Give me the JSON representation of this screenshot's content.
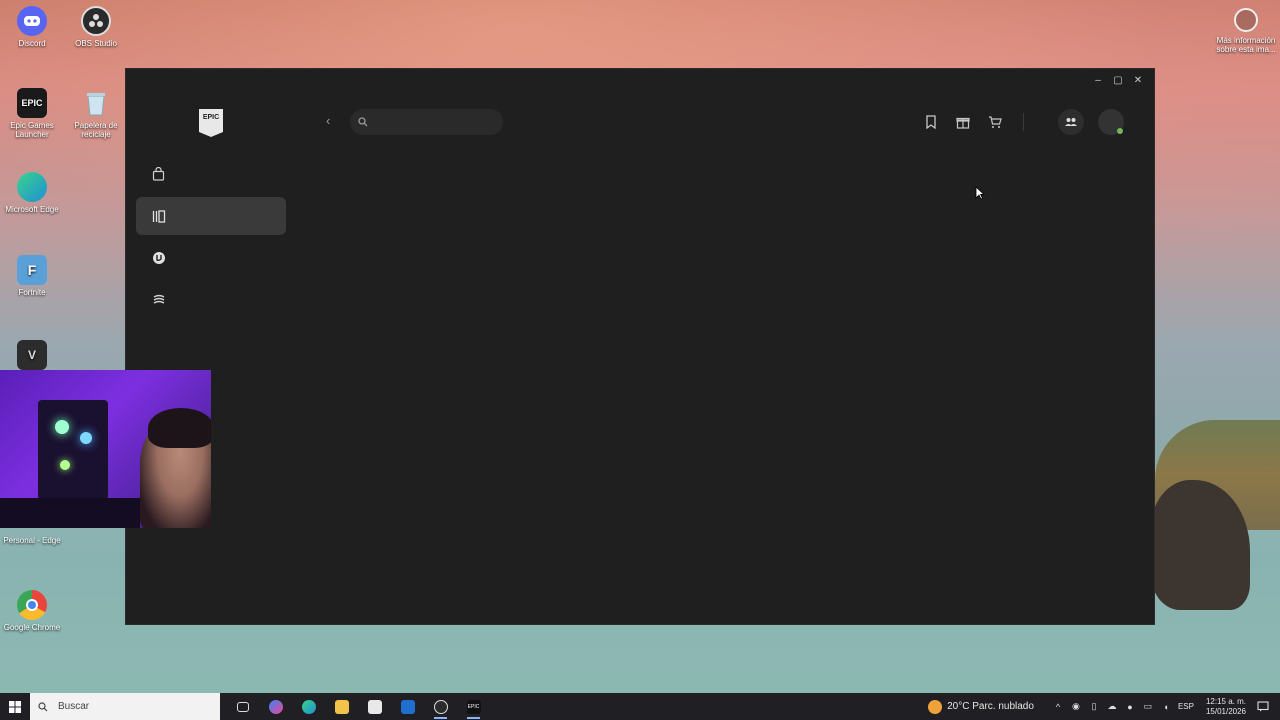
{
  "desktop": {
    "icons": [
      {
        "label": "Discord",
        "icon": "discord-icon",
        "color": "#5865f2"
      },
      {
        "label": "OBS Studio",
        "icon": "obs-icon",
        "color": "#2b2b2b"
      },
      {
        "label": "Epic Games Launcher",
        "icon": "epic-games-icon",
        "color": "#1a1a1a",
        "glyph": "EPIC"
      },
      {
        "label": "Papelera de reciclaje",
        "icon": "recycle-bin-icon",
        "color": "#cfe3f0"
      },
      {
        "label": "Microsoft Edge",
        "icon": "edge-icon",
        "color": "#1f8fd6"
      },
      {
        "label": "Fortnite",
        "icon": "fortnite-icon",
        "color": "#5aa0d8",
        "glyph": "F"
      },
      {
        "label": "Personal - Edge",
        "icon": "edge-profile-icon",
        "color": "#1f8fd6"
      },
      {
        "label": "Google Chrome",
        "icon": "chrome-icon",
        "color": "#e8453c"
      }
    ],
    "corner_info": "Más información sobre esta ima..."
  },
  "window": {
    "controls": {
      "minimize": "–",
      "maximize": "▢",
      "close": "✕"
    },
    "logo_text": "EPIC",
    "search": {
      "placeholder": "",
      "value": ""
    },
    "nav_items": [
      {
        "name": "store",
        "icon": "shopping-bag-icon",
        "active": false
      },
      {
        "name": "library",
        "icon": "library-icon",
        "active": true
      },
      {
        "name": "unreal-engine",
        "icon": "unreal-engine-icon",
        "active": false
      },
      {
        "name": "fab",
        "icon": "fab-icon",
        "active": false
      }
    ]
  },
  "taskbar": {
    "search_label": "Buscar",
    "weather": "20°C  Parc. nublado",
    "language": "ESP",
    "time": "12:15 a. m.",
    "date": "15/01/2026"
  },
  "colors": {
    "window_bg": "#1f1f1f",
    "active_nav": "#3a3a3a",
    "taskbar": "#202024",
    "online_status": "#7ab35c"
  }
}
